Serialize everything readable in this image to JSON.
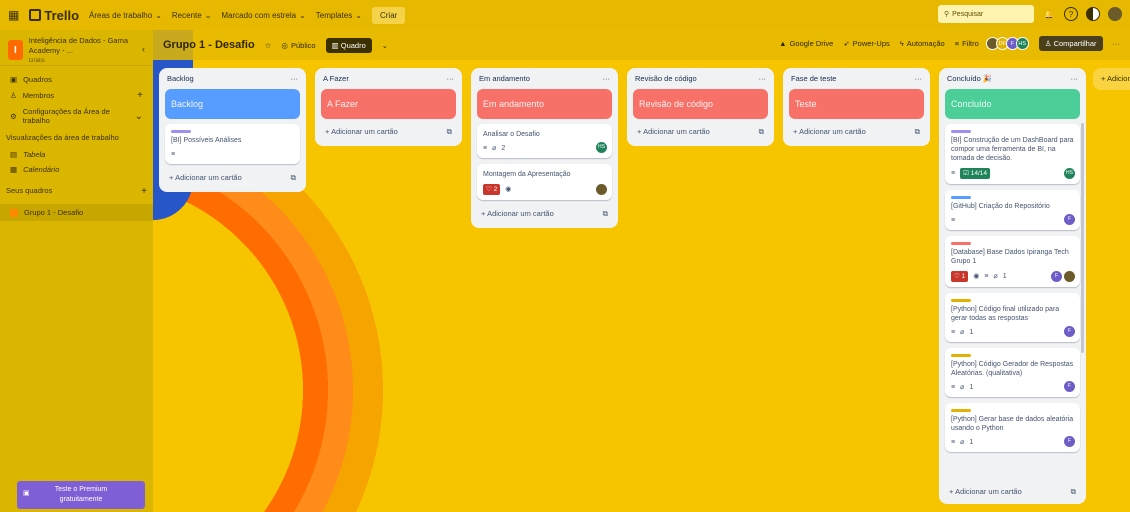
{
  "topbar": {
    "app_name": "Trello",
    "nav": [
      "Áreas de trabalho",
      "Recente",
      "Marcado com estrela",
      "Templates"
    ],
    "create": "Criar",
    "search_placeholder": "Pesquisar"
  },
  "sidebar": {
    "workspace_name": "Inteligência de Dados - Gama Academy - ...",
    "workspace_initial": "I",
    "plan": "Grátis",
    "items": [
      {
        "label": "Quadros",
        "icon": "board-icon"
      },
      {
        "label": "Membros",
        "icon": "members-icon"
      },
      {
        "label": "Configurações da Área de trabalho",
        "icon": "gear-icon"
      }
    ],
    "views_heading": "Visualizações da área de trabalho",
    "views": [
      "Tabela",
      "Calendário"
    ],
    "boards_heading": "Seus quadros",
    "boards": [
      "Grupo 1 - Desafio"
    ],
    "premium": "Teste o Premium gratuitamente"
  },
  "board": {
    "title": "Grupo 1 - Desafio",
    "visibility": "Público",
    "view": "Quadro",
    "actions": [
      "Google Drive",
      "Power-Ups",
      "Automação",
      "Filtro"
    ],
    "share": "Compartilhar",
    "avatars": [
      "DF",
      "F",
      "HS"
    ],
    "add_list": "+ Adicionar"
  },
  "add_card_label": "Adicionar um cartão",
  "lists": [
    {
      "title": "Backlog",
      "cover": "Backlog",
      "cover_color": "#579dff",
      "cards": [
        {
          "text": "[BI] Possíveis Análises",
          "label_color": "#9f8fef"
        }
      ]
    },
    {
      "title": "A Fazer",
      "cover": "A Fazer",
      "cover_color": "#f87168",
      "cards": []
    },
    {
      "title": "Em andamento",
      "cover": "Em andamento",
      "cover_color": "#f87168",
      "cards": [
        {
          "text": "Analisar o Desafio",
          "attachments": "2",
          "avatar": "HS"
        },
        {
          "text": "Montagem da Apresentação",
          "comments": "2"
        }
      ]
    },
    {
      "title": "Revisão de código",
      "cover": "Revisão de código",
      "cover_color": "#f87168",
      "cards": []
    },
    {
      "title": "Fase de teste",
      "cover": "Teste",
      "cover_color": "#f87168",
      "cards": []
    },
    {
      "title": "Concluído",
      "cover": "Concluído",
      "cover_color": "#4bce97",
      "cards": [
        {
          "text": "[BI] Construção de um DashBoard para compor uma ferramenta de BI, na tomada de decisão.",
          "checklist": "14/14",
          "avatar": "HS",
          "label_color": "#9f8fef"
        },
        {
          "text": "[GitHub] Criação do Repositório",
          "avatar": "F",
          "label_color": "#579dff"
        },
        {
          "text": "[Database] Base Dados Ipiranga Tech Grupo 1",
          "comments": "1",
          "attachments": "1",
          "avatar": "F",
          "label_color": "#f87168"
        },
        {
          "text": "[Python] Código final utilizado para gerar todas as respostas",
          "attachments": "1",
          "avatar": "F",
          "label_color": "#e2b203"
        },
        {
          "text": "[Python] Código Gerador de Respostas Aleatórias. (qualitativa)",
          "attachments": "1",
          "avatar": "F",
          "label_color": "#e2b203"
        },
        {
          "text": "[Python] Gerar base de dados aleatória usando o Python",
          "attachments": "1",
          "avatar": "F",
          "label_color": "#e2b203"
        }
      ]
    }
  ]
}
